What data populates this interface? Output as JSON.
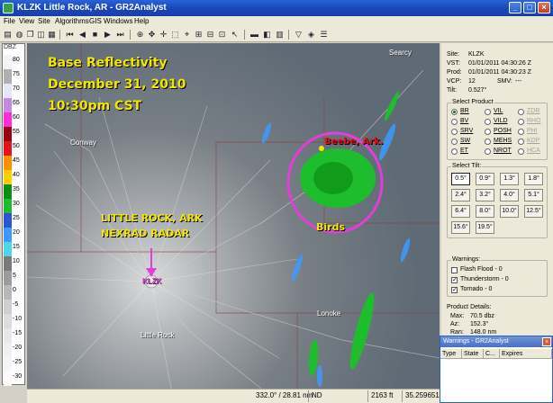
{
  "window": {
    "title": "KLZK Little Rock, AR - GR2Analyst",
    "minimize_glyph": "_",
    "maximize_glyph": "□",
    "close_glyph": "×"
  },
  "menu": [
    "File",
    "View",
    "Site",
    "Algorithms",
    "GIS",
    "Windows",
    "Help"
  ],
  "colors": {
    "title_bar": "#1847b8",
    "echo_green": "#1ebd2e",
    "highlight_circle": "#e040d8",
    "overlay_text": "#f2e600",
    "callout_red": "#e8121b",
    "arrow": "#e040d8"
  },
  "colorbar": {
    "unit": "DBZ",
    "levels": [
      {
        "label": "80",
        "color": "#f4f4f4"
      },
      {
        "label": "75",
        "color": "#b0b0b0"
      },
      {
        "label": "70",
        "color": "#e7e7f6"
      },
      {
        "label": "65",
        "color": "#c78ae0"
      },
      {
        "label": "60",
        "color": "#ff2bd9"
      },
      {
        "label": "55",
        "color": "#9a0010"
      },
      {
        "label": "50",
        "color": "#e8121b"
      },
      {
        "label": "45",
        "color": "#ff8f00"
      },
      {
        "label": "40",
        "color": "#ffd000"
      },
      {
        "label": "35",
        "color": "#0a8f12"
      },
      {
        "label": "30",
        "color": "#1ebd2e"
      },
      {
        "label": "25",
        "color": "#2a55d8"
      },
      {
        "label": "20",
        "color": "#3d9bff"
      },
      {
        "label": "15",
        "color": "#4ed7e8"
      },
      {
        "label": "10",
        "color": "#7a7a7a"
      },
      {
        "label": "5",
        "color": "#9c9c9c"
      },
      {
        "label": "0",
        "color": "#b8b8b8"
      },
      {
        "label": "-5",
        "color": "#cfcfcf"
      },
      {
        "label": "-10",
        "color": "#dddddd"
      },
      {
        "label": "-15",
        "color": "#e8e8e8"
      },
      {
        "label": "-20",
        "color": "#f0f0f0"
      },
      {
        "label": "-25",
        "color": "#f6f6f6"
      },
      {
        "label": "-30",
        "color": "#fbfbfb"
      }
    ]
  },
  "map": {
    "overlay_title": [
      "Base Reflectivity",
      "December 31, 2010",
      "10:30pm CST"
    ],
    "radar_label": [
      "LITTLE ROCK, ARK",
      "NEXRAD RADAR"
    ],
    "station_id": "KLZK",
    "callout_city": "Beebe, Ark.",
    "callout_birds": "Birds",
    "cities": [
      "Searcy",
      "Conway",
      "Little Rock",
      "Lonoke"
    ]
  },
  "status_bar": {
    "bearing_range": "332.0° / 28.81 nm",
    "value": "ND",
    "elevation": "2163 ft",
    "lat": "35.259651,"
  },
  "site_info": {
    "site_label": "Site:",
    "site": "KLZK",
    "vst_label": "VST:",
    "vst": "01/01/2011 04:30:26 Z",
    "prod_label": "Prod:",
    "prod": "01/01/2011 04:30:23 Z",
    "vcp_label": "VCP:",
    "vcp": "12",
    "smv_label": "SMV:",
    "smv": "---",
    "tilt_label": "Tilt:",
    "tilt": "0.527°"
  },
  "select_product": {
    "title": "Select Product",
    "options": [
      {
        "label": "BR",
        "selected": true,
        "enabled": true
      },
      {
        "label": "VIL",
        "selected": false,
        "enabled": true
      },
      {
        "label": "ZDR",
        "selected": false,
        "enabled": false
      },
      {
        "label": "BV",
        "selected": false,
        "enabled": true
      },
      {
        "label": "VILD",
        "selected": false,
        "enabled": true
      },
      {
        "label": "RHO",
        "selected": false,
        "enabled": false
      },
      {
        "label": "SRV",
        "selected": false,
        "enabled": true
      },
      {
        "label": "POSH",
        "selected": false,
        "enabled": true
      },
      {
        "label": "PHI",
        "selected": false,
        "enabled": false
      },
      {
        "label": "SW",
        "selected": false,
        "enabled": true
      },
      {
        "label": "MEHS",
        "selected": false,
        "enabled": true
      },
      {
        "label": "KDP",
        "selected": false,
        "enabled": false
      },
      {
        "label": "ET",
        "selected": false,
        "enabled": true
      },
      {
        "label": "NROT",
        "selected": false,
        "enabled": true
      },
      {
        "label": "HCA",
        "selected": false,
        "enabled": false
      }
    ]
  },
  "select_tilt": {
    "title": "Select Tilt:",
    "tilts": [
      "0.5°",
      "0.9°",
      "1.3°",
      "1.8°",
      "2.4°",
      "3.2°",
      "4.0°",
      "5.1°",
      "6.4°",
      "8.0°",
      "10.0°",
      "12.5°",
      "15.6°",
      "19.5°"
    ],
    "selected": "0.5°"
  },
  "warnings": {
    "title": "Warnings:",
    "items": [
      {
        "label": "Flash Flood - 0",
        "checked": false
      },
      {
        "label": "Thunderstorm - 0",
        "checked": true
      },
      {
        "label": "Tornado - 0",
        "checked": true
      }
    ]
  },
  "product_details": {
    "title": "Product Details:",
    "max_label": "Max:",
    "max": "70.5 dbz",
    "az_label": "Az:",
    "az": "152.3°",
    "ran_label": "Ran:",
    "ran": "148.0 nm"
  },
  "warnings_window": {
    "title": "Warnings - GR2Analyst",
    "columns": [
      "Type",
      "State",
      "C...",
      "Expires"
    ]
  }
}
